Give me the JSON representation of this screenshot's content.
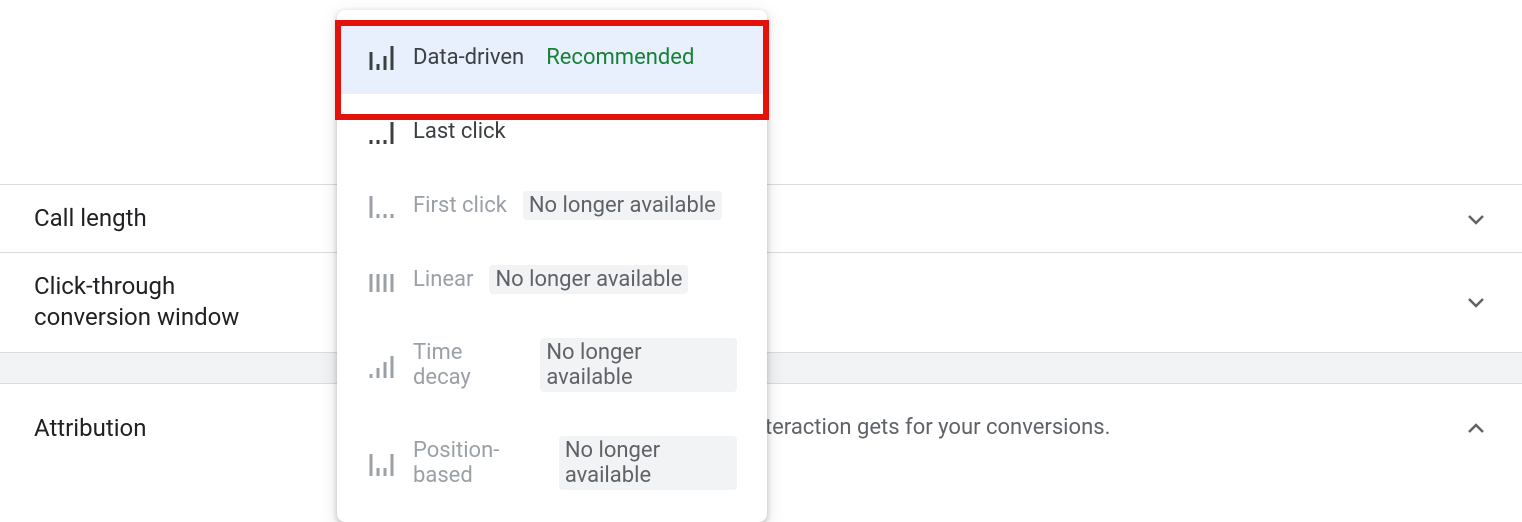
{
  "settings": {
    "call_length_label": "Call length",
    "conversion_window_label": "Click-through conversion window",
    "attribution_label": "Attribution",
    "attribution_description": "h credit each ad interaction gets for your conversions."
  },
  "dropdown": {
    "items": [
      {
        "label": "Data-driven",
        "badge": "Recommended",
        "badge_type": "recommended",
        "selected": true,
        "disabled": false,
        "icon": "bars-variable"
      },
      {
        "label": "Last click",
        "badge": "",
        "badge_type": "",
        "selected": false,
        "disabled": false,
        "icon": "bars-ascending-short"
      },
      {
        "label": "First click",
        "badge": "No longer available",
        "badge_type": "unavailable",
        "selected": false,
        "disabled": true,
        "icon": "bars-descending"
      },
      {
        "label": "Linear",
        "badge": "No longer available",
        "badge_type": "unavailable",
        "selected": false,
        "disabled": true,
        "icon": "bars-equal"
      },
      {
        "label": "Time decay",
        "badge": "No longer available",
        "badge_type": "unavailable",
        "selected": false,
        "disabled": true,
        "icon": "bars-ascending"
      },
      {
        "label": "Position-based",
        "badge": "No longer available",
        "badge_type": "unavailable",
        "selected": false,
        "disabled": true,
        "icon": "bars-u-shape"
      }
    ]
  }
}
